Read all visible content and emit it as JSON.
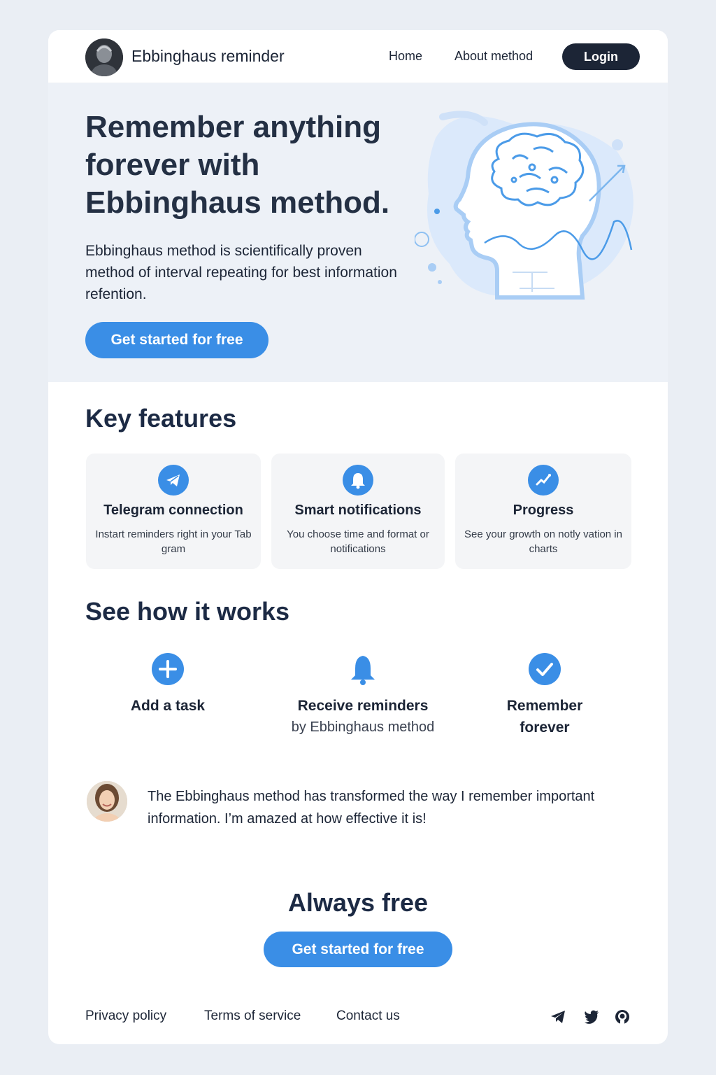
{
  "header": {
    "brand": "Ebbinghaus reminder",
    "nav": {
      "home": "Home",
      "about": "About method"
    },
    "login": "Login"
  },
  "hero": {
    "title": "Remember anything forever with Ebbinghaus method.",
    "subtitle": "Ebbinghaus method is scientifically proven method of interval repeating for best information refention.",
    "cta": "Get started for free",
    "illustration_icon": "brain-head-icon"
  },
  "features": {
    "title": "Key features",
    "items": [
      {
        "icon": "telegram-icon",
        "title": "Telegram connection",
        "desc": "Instart reminders right in your Tab gram"
      },
      {
        "icon": "bell-icon",
        "title": "Smart notifications",
        "desc": "You choose time and format or notifications"
      },
      {
        "icon": "progress-icon",
        "title": "Progress",
        "desc": "See your growth on notly vation in charts"
      }
    ]
  },
  "how": {
    "title": "See how it works",
    "steps": [
      {
        "icon": "plus-circle-icon",
        "title": "Add a task",
        "sub": ""
      },
      {
        "icon": "bell-icon",
        "title": "Receive reminders",
        "sub": "by Ebbinghaus method"
      },
      {
        "icon": "check-circle-icon",
        "title": "Remember forever",
        "sub": ""
      }
    ]
  },
  "testimonial": {
    "quote": "The Ebbinghaus method has transformed the way I remember important information. I’m amazed at how effective it is!"
  },
  "bottom": {
    "title": "Always free",
    "cta": "Get started for free"
  },
  "footer": {
    "links": [
      "Privacy policy",
      "Terms of service",
      "Contact us"
    ],
    "social_icons": [
      "telegram-icon",
      "twitter-icon",
      "github-icon"
    ]
  },
  "colors": {
    "accent": "#3a8ee6",
    "dark": "#1c2536",
    "hero_bg": "#edf1f7",
    "page_bg": "#eaeef4"
  }
}
